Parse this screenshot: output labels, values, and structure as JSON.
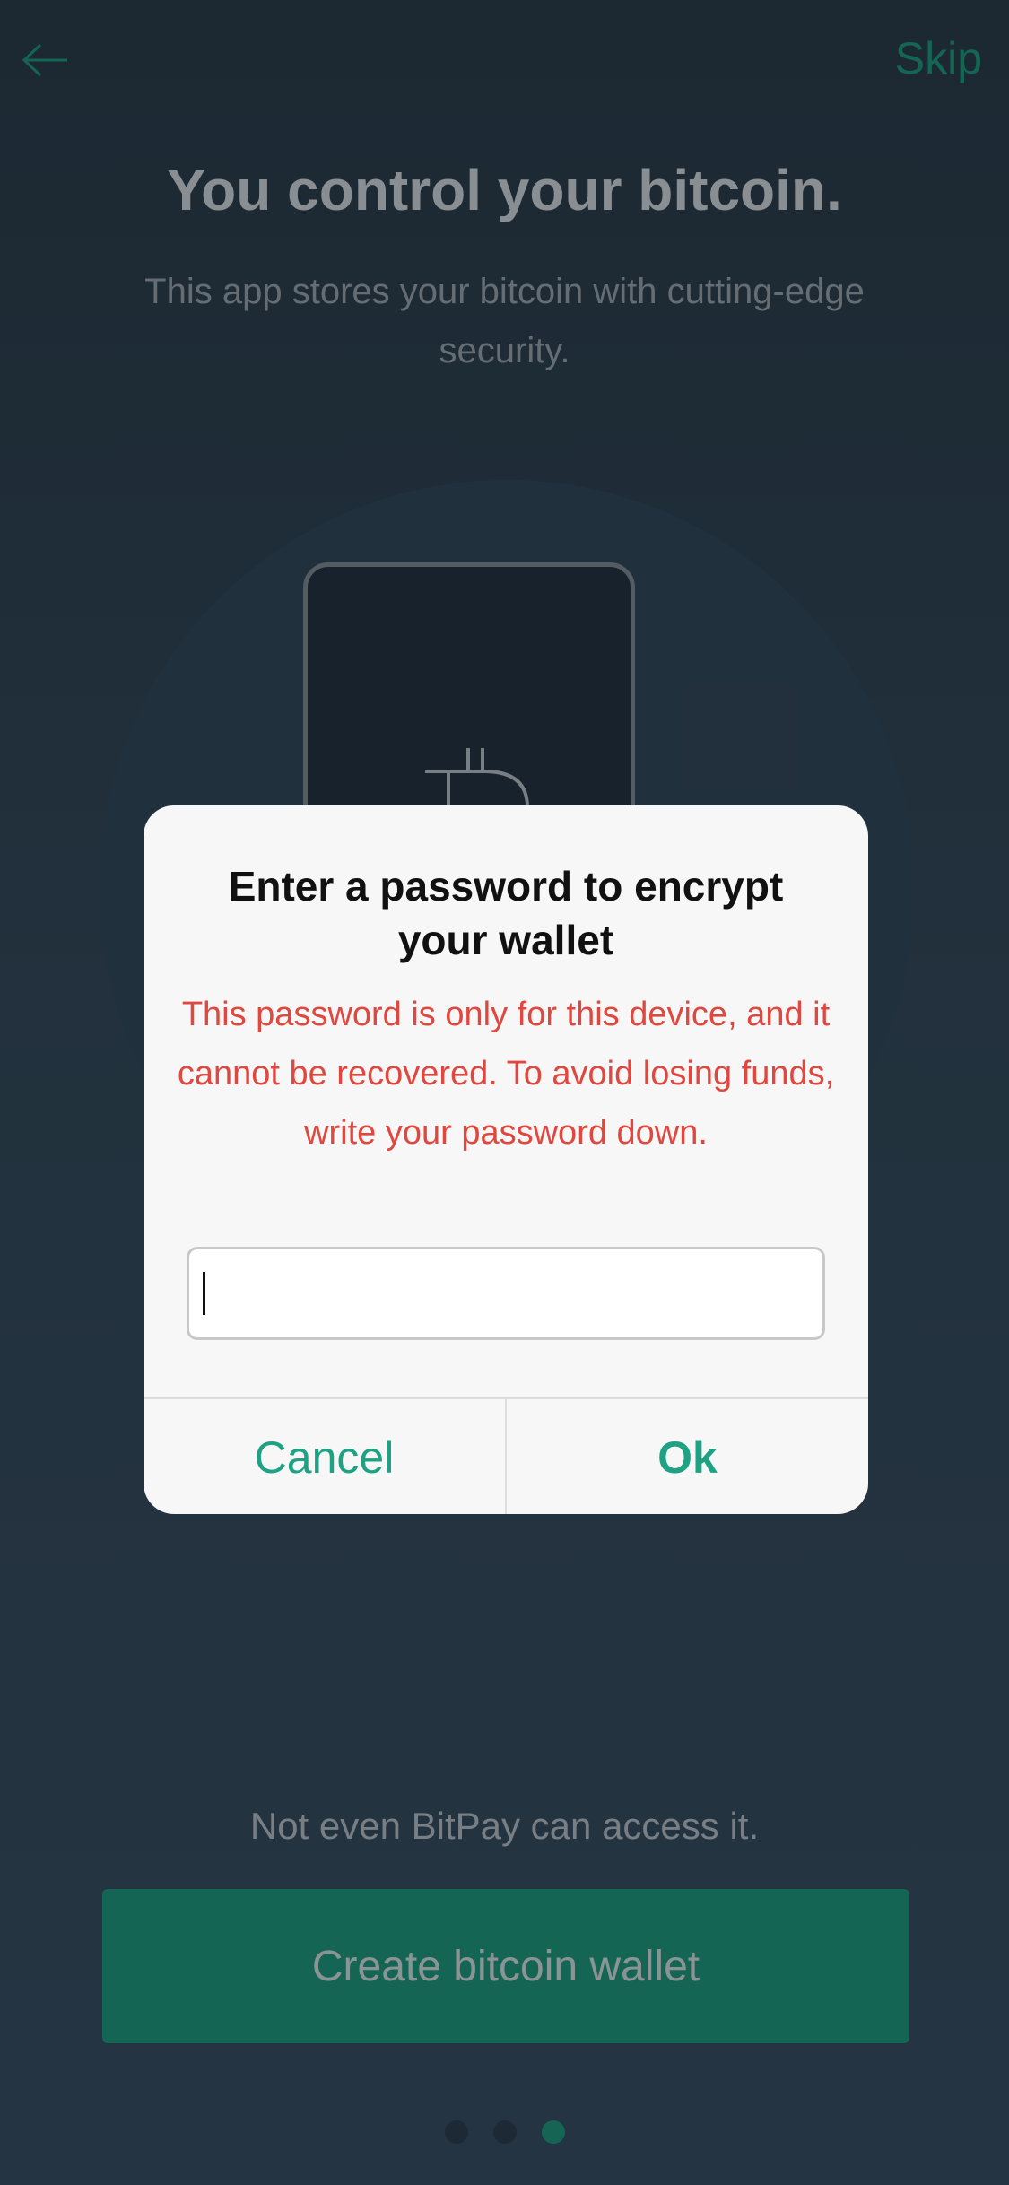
{
  "header": {
    "back_icon": "arrow-left-icon",
    "skip_label": "Skip"
  },
  "onboarding": {
    "title": "You control your bitcoin.",
    "subtitle": "This app stores your bitcoin with cutting-edge security.",
    "illustration_icon": "bitcoin-phone-illustration",
    "tagline": "Not even BitPay can access it.",
    "create_button_label": "Create bitcoin wallet",
    "page_indicator": {
      "total": 3,
      "active": 3
    }
  },
  "dialog": {
    "title": "Enter a password to encrypt your wallet",
    "message": "This password is only for this device, and it cannot be recovered. To avoid losing funds, write your password down.",
    "input_value": "",
    "cancel_label": "Cancel",
    "ok_label": "Ok"
  },
  "colors": {
    "accent": "#1ea283",
    "warning": "#e0483f",
    "background": "#2a3a47",
    "dialog_background": "#f7f7f8"
  }
}
